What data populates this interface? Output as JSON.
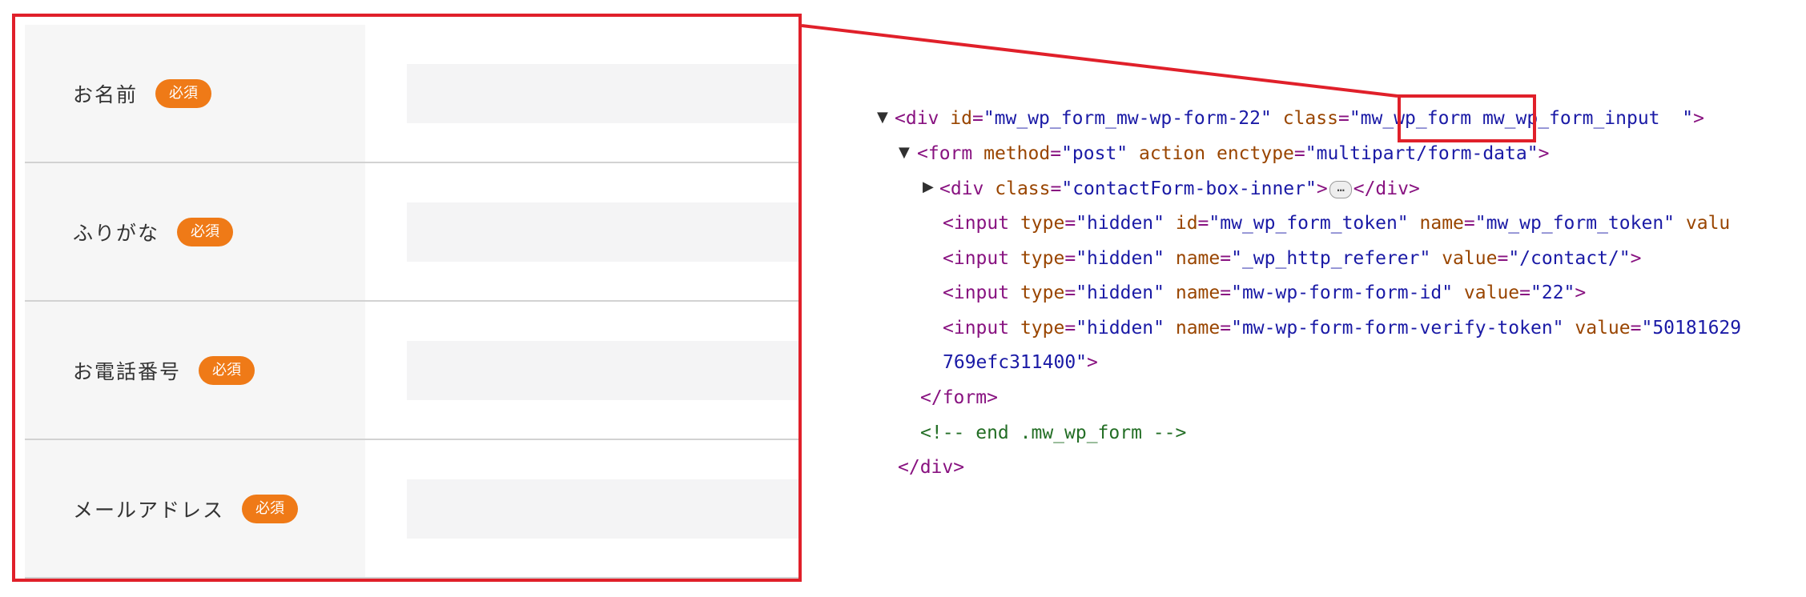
{
  "form": {
    "required_badge": "必須",
    "fields": [
      {
        "label": "お名前"
      },
      {
        "label": "ふりがな"
      },
      {
        "label": "お電話番号"
      },
      {
        "label": "メールアドレス"
      }
    ]
  },
  "devtools": {
    "l1": {
      "open": "<div",
      "id_attr": "id",
      "id_val": "\"mw_wp_form_mw-wp-form-22\"",
      "class_attr": "class",
      "class_val": "\"mw_wp_form mw_wp_form_input  \"",
      "close": ">"
    },
    "l2": {
      "open": "<form",
      "method_attr": "method",
      "method_val": "\"post\"",
      "action_attr": "action",
      "enctype_attr": "enctype",
      "enctype_val": "\"multipart/form-data\"",
      "close": ">"
    },
    "l3": {
      "open": "<div",
      "class_attr": "class",
      "class_val": "\"contactForm-box-inner\"",
      "gt": ">",
      "ellipsis": "…",
      "close": "</div>"
    },
    "l4": {
      "open": "<input",
      "type_attr": "type",
      "type_val": "\"hidden\"",
      "id_attr": "id",
      "id_val": "\"mw_wp_form_token\"",
      "name_attr": "name",
      "name_val": "\"mw_wp_form_token\"",
      "value_attr": "valu"
    },
    "l5": {
      "open": "<input",
      "type_attr": "type",
      "type_val": "\"hidden\"",
      "name_attr": "name",
      "name_val": "\"_wp_http_referer\"",
      "value_attr": "value",
      "value_val": "\"/contact/\"",
      "close": ">"
    },
    "l6": {
      "open": "<input",
      "type_attr": "type",
      "type_val": "\"hidden\"",
      "name_attr": "name",
      "name_val": "\"mw-wp-form-form-id\"",
      "value_attr": "value",
      "value_val": "\"22\"",
      "close": ">"
    },
    "l7": {
      "open": "<input",
      "type_attr": "type",
      "type_val": "\"hidden\"",
      "name_attr": "name",
      "name_val": "\"mw-wp-form-form-verify-token\"",
      "value_attr": "value",
      "value_val": "\"50181629"
    },
    "l8": {
      "value_val": "769efc311400\"",
      "close": ">"
    },
    "l9": {
      "text": "</form>"
    },
    "l10": {
      "text": "<!-- end .mw_wp_form -->"
    },
    "l11": {
      "text": "</div>"
    }
  },
  "colors": {
    "highlight_border": "#e0202a",
    "badge": "#ef7a17",
    "tag": "#881280",
    "attr": "#994500",
    "value": "#1a1aa6",
    "comment": "#236e25"
  }
}
